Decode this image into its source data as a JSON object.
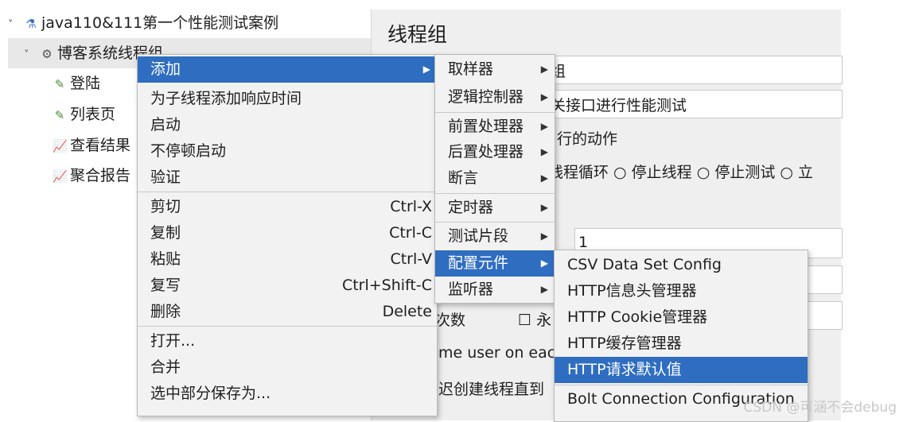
{
  "tree": {
    "root": "java110&111第一个性能测试案例",
    "group": "博客系统线程组",
    "children": [
      "登陆",
      "列表页",
      "查看结果",
      "聚合报告"
    ]
  },
  "panel": {
    "title": "线程组",
    "name_tail": "组",
    "comment_tail": "关接口进行性能测试",
    "error_action_tail": "行的动作",
    "radios": "线程循环 ○ 停止线程 ○ 停止测试 ○ 立",
    "threads_value": "1",
    "loop_label_tail": "次数",
    "forever": "☐ 永",
    "same_user": "me user on each",
    "delay_create": "迟创建线程直到"
  },
  "context_menu": {
    "items": [
      {
        "label": "添加",
        "shortcut": "",
        "submenu": true
      },
      {
        "label": "为子线程添加响应时间",
        "shortcut": ""
      },
      {
        "label": "启动",
        "shortcut": ""
      },
      {
        "label": "不停顿启动",
        "shortcut": ""
      },
      {
        "label": "验证",
        "shortcut": ""
      },
      {
        "label": "剪切",
        "shortcut": "Ctrl-X"
      },
      {
        "label": "复制",
        "shortcut": "Ctrl-C"
      },
      {
        "label": "粘贴",
        "shortcut": "Ctrl-V"
      },
      {
        "label": "复写",
        "shortcut": "Ctrl+Shift-C"
      },
      {
        "label": "删除",
        "shortcut": "Delete"
      },
      {
        "label": "打开...",
        "shortcut": ""
      },
      {
        "label": "合并",
        "shortcut": ""
      },
      {
        "label": "选中部分保存为...",
        "shortcut": ""
      }
    ]
  },
  "add_submenu": {
    "items": [
      "取样器",
      "逻辑控制器",
      "前置处理器",
      "后置处理器",
      "断言",
      "定时器",
      "测试片段",
      "配置元件",
      "监听器"
    ]
  },
  "config_submenu": {
    "items": [
      "CSV Data Set Config",
      "HTTP信息头管理器",
      "HTTP Cookie管理器",
      "HTTP缓存管理器",
      "HTTP请求默认值",
      "Bolt Connection Configuration"
    ]
  },
  "watermark": "CSDN @可涵不会debug",
  "colors": {
    "highlight": "#2f6dc0",
    "menu_bg": "#f2f2f2",
    "panel_bg": "#efefef"
  }
}
